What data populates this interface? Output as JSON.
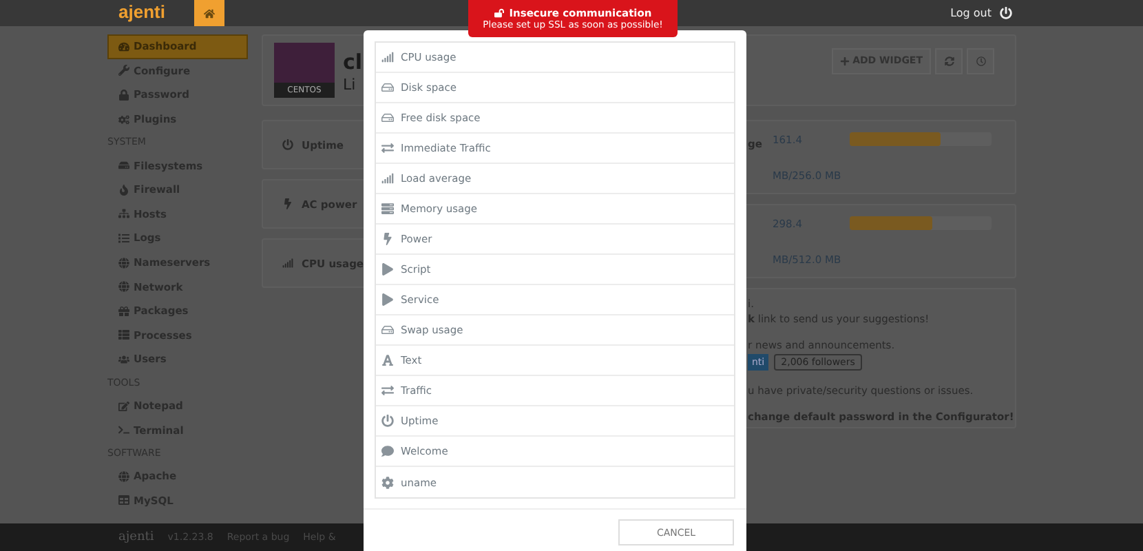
{
  "header": {
    "logo": "ajenti",
    "logout": "Log out"
  },
  "alert": {
    "title": "Insecure communication",
    "message": "Please set up SSL as soon as possible!"
  },
  "sidebar": {
    "sections": [
      {
        "items": [
          {
            "label": "Dashboard",
            "selected": true
          },
          {
            "label": "Configure",
            "selected": false
          },
          {
            "label": "Password",
            "selected": false
          },
          {
            "label": "Plugins",
            "selected": false
          }
        ]
      },
      {
        "title": "SYSTEM",
        "items": [
          {
            "label": "Filesystems",
            "selected": false
          },
          {
            "label": "Firewall",
            "selected": false
          },
          {
            "label": "Hosts",
            "selected": false
          },
          {
            "label": "Logs",
            "selected": false
          },
          {
            "label": "Nameservers",
            "selected": false
          },
          {
            "label": "Network",
            "selected": false
          },
          {
            "label": "Packages",
            "selected": false
          },
          {
            "label": "Processes",
            "selected": false
          },
          {
            "label": "Users",
            "selected": false
          }
        ]
      },
      {
        "title": "TOOLS",
        "items": [
          {
            "label": "Notepad",
            "selected": false
          },
          {
            "label": "Terminal",
            "selected": false
          }
        ]
      },
      {
        "title": "SOFTWARE",
        "items": [
          {
            "label": "Apache",
            "selected": false
          },
          {
            "label": "MySQL",
            "selected": false
          }
        ]
      }
    ]
  },
  "overview": {
    "badge": "CENTOS",
    "title": "cl",
    "subtitle": "Li",
    "add_widget": "ADD WIDGET"
  },
  "widgets_left": [
    {
      "label": "Uptime"
    },
    {
      "label": "AC power"
    },
    {
      "label": "CPU usage"
    }
  ],
  "widgets_right": [
    {
      "label": "ge",
      "value": "161.4",
      "total": "MB/256.0 MB",
      "level": 0.64
    },
    {
      "value": "298.4",
      "total": "MB/512.0 MB",
      "level": 0.58
    }
  ],
  "welcome": {
    "intro": "i.",
    "suggestions": "**k** link to send us your suggestions!",
    "news": "r news and announcements.",
    "follow_button": "nti",
    "followers": "2,006 followers",
    "security": "u have private/security questions or issues.",
    "warning": "change default password in the Configurator!"
  },
  "dialog": {
    "items": [
      "CPU usage",
      "Disk space",
      "Free disk space",
      "Immediate Traffic",
      "Load average",
      "Memory usage",
      "Power",
      "Script",
      "Service",
      "Swap usage",
      "Text",
      "Traffic",
      "Uptime",
      "Welcome",
      "uname"
    ],
    "cancel": "CANCEL"
  },
  "footer": {
    "logo": "ajenti",
    "version": "v1.2.23.8",
    "links": [
      "Report a bug",
      "Help &"
    ]
  }
}
